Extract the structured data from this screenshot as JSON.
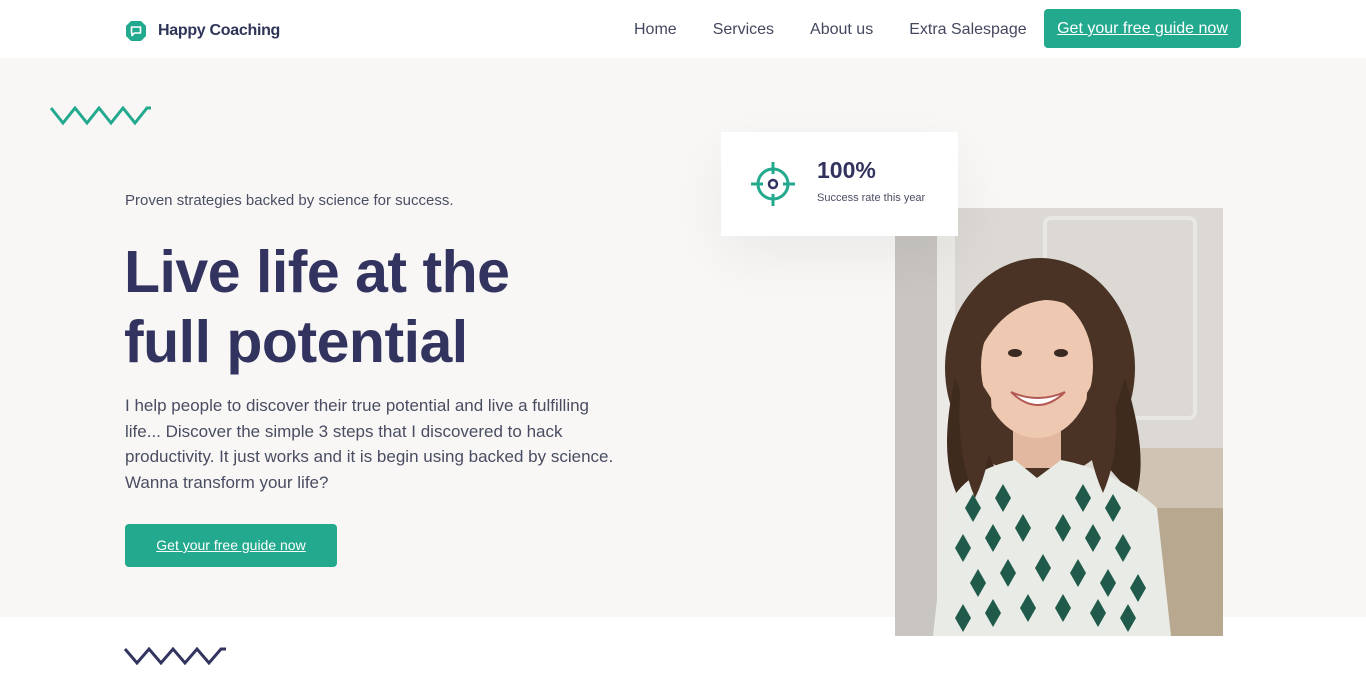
{
  "brand": {
    "name": "Happy Coaching",
    "accent": "#22a98e",
    "icon": "chat-bubble-icon"
  },
  "nav": {
    "items": [
      "Home",
      "Services",
      "About us",
      "Extra Salespage"
    ],
    "cta": "Get your free guide now"
  },
  "hero": {
    "eyebrow": "Proven strategies backed by science for success.",
    "headline_line1": "Live life at the",
    "headline_line2": "full potential",
    "description": "I help people to discover their true potential and live a fulfilling life... Discover the simple 3 steps that I discovered to hack productivity. It just works and it is begin using backed by science. Wanna transform your life?",
    "cta": "Get your free guide now"
  },
  "stat": {
    "value": "100%",
    "label": "Success rate this year",
    "icon": "target-icon"
  }
}
